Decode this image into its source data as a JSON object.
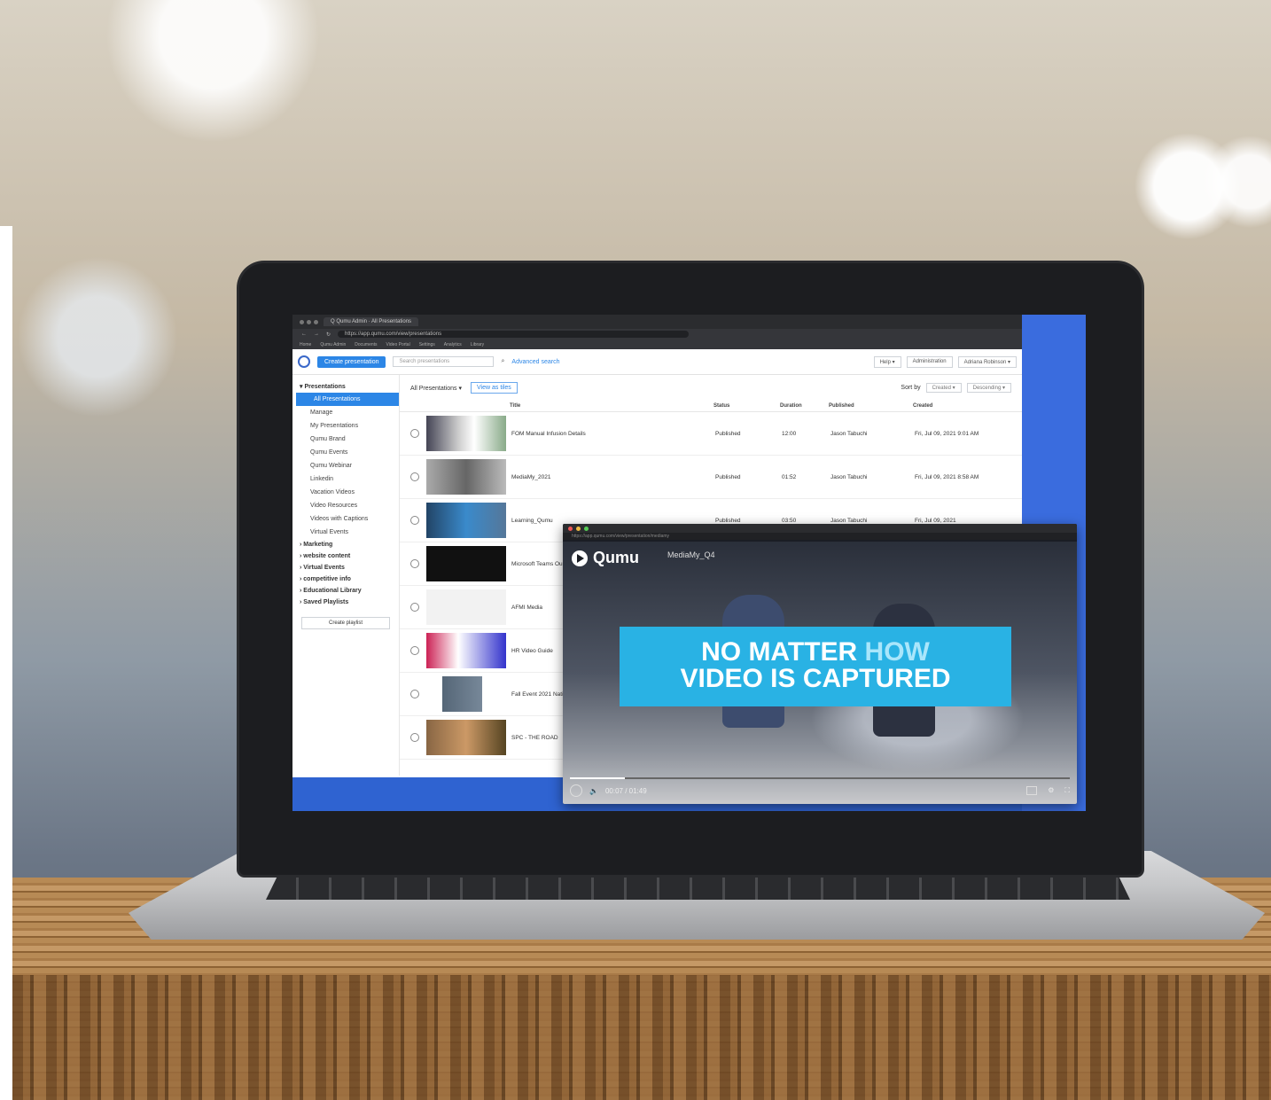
{
  "browser": {
    "tab_title": "Q  Qumu Admin · All Presentations",
    "url": "https://app.qumu.com/view/presentations",
    "bookmarks": [
      "Home",
      "Qumu Admin",
      "Documents",
      "Video Portal",
      "Settings",
      "Analytics",
      "Library"
    ]
  },
  "toolbar": {
    "create_label": "Create presentation",
    "search_placeholder": "Search presentations",
    "advanced_search": "Advanced search",
    "help": "Help ▾",
    "admin": "Administration",
    "user": "Adriana Robinson ▾"
  },
  "sidebar": {
    "presentations_head": "▾ Presentations",
    "items": [
      "All Presentations",
      "Manage",
      "My Presentations",
      "Qumu Brand",
      "Qumu Events",
      "Qumu Webinar",
      "Linkedin",
      "Vacation Videos",
      "Video Resources",
      "Videos with Captions",
      "Virtual Events"
    ],
    "groups": [
      "› Marketing",
      "› website content",
      "› Virtual Events",
      "› competitive info",
      "› Educational Library",
      "› Saved Playlists"
    ],
    "create_playlist": "Create playlist"
  },
  "content": {
    "heading": "All Presentations ▾",
    "view_tab": "View as tiles",
    "sort_by": "Sort by",
    "sort_field": "Created ▾",
    "sort_order": "Descending ▾",
    "columns": [
      "Title",
      "Status",
      "Duration",
      "Published",
      "Created"
    ],
    "rows": [
      {
        "title": "FOM Manual Infusion Details",
        "status": "Published",
        "duration": "12:00",
        "published": "Jason Tabuchi",
        "created": "Fri, Jul 09, 2021 9:01 AM"
      },
      {
        "title": "MediaMy_2021",
        "status": "Published",
        "duration": "01:52",
        "published": "Jason Tabuchi",
        "created": "Fri, Jul 09, 2021 8:58 AM"
      },
      {
        "title": "Learning_Qumu",
        "status": "Published",
        "duration": "03:50",
        "published": "Jason Tabuchi",
        "created": "Fri, Jul 09, 2021"
      },
      {
        "title": "Microsoft Teams Our Teamwork",
        "status": "",
        "duration": "",
        "published": "",
        "created": ""
      },
      {
        "title": "AFMI Media",
        "status": "",
        "duration": "",
        "published": "",
        "created": ""
      },
      {
        "title": "HR Video Guide",
        "status": "",
        "duration": "",
        "published": "",
        "created": ""
      },
      {
        "title": "Fall Event 2021 National Group Q1 2021",
        "status": "",
        "duration": "",
        "published": "",
        "created": ""
      },
      {
        "title": "SPC - THE ROAD",
        "status": "",
        "duration": "",
        "published": "",
        "created": ""
      }
    ]
  },
  "player": {
    "url": "https://app.qumu.com/view/presentation/mediamy",
    "brand": "Qumu",
    "video_title": "MediaMy_Q4",
    "banner_line1_a": "NO MATTER ",
    "banner_line1_b": "HOW",
    "banner_line2": "VIDEO IS CAPTURED",
    "time": "00:07 / 01:49",
    "progress": 0.11
  },
  "colors": {
    "accent": "#2c86e6",
    "banner": "#29b2e4",
    "screen_bg": "#2f63d1"
  }
}
